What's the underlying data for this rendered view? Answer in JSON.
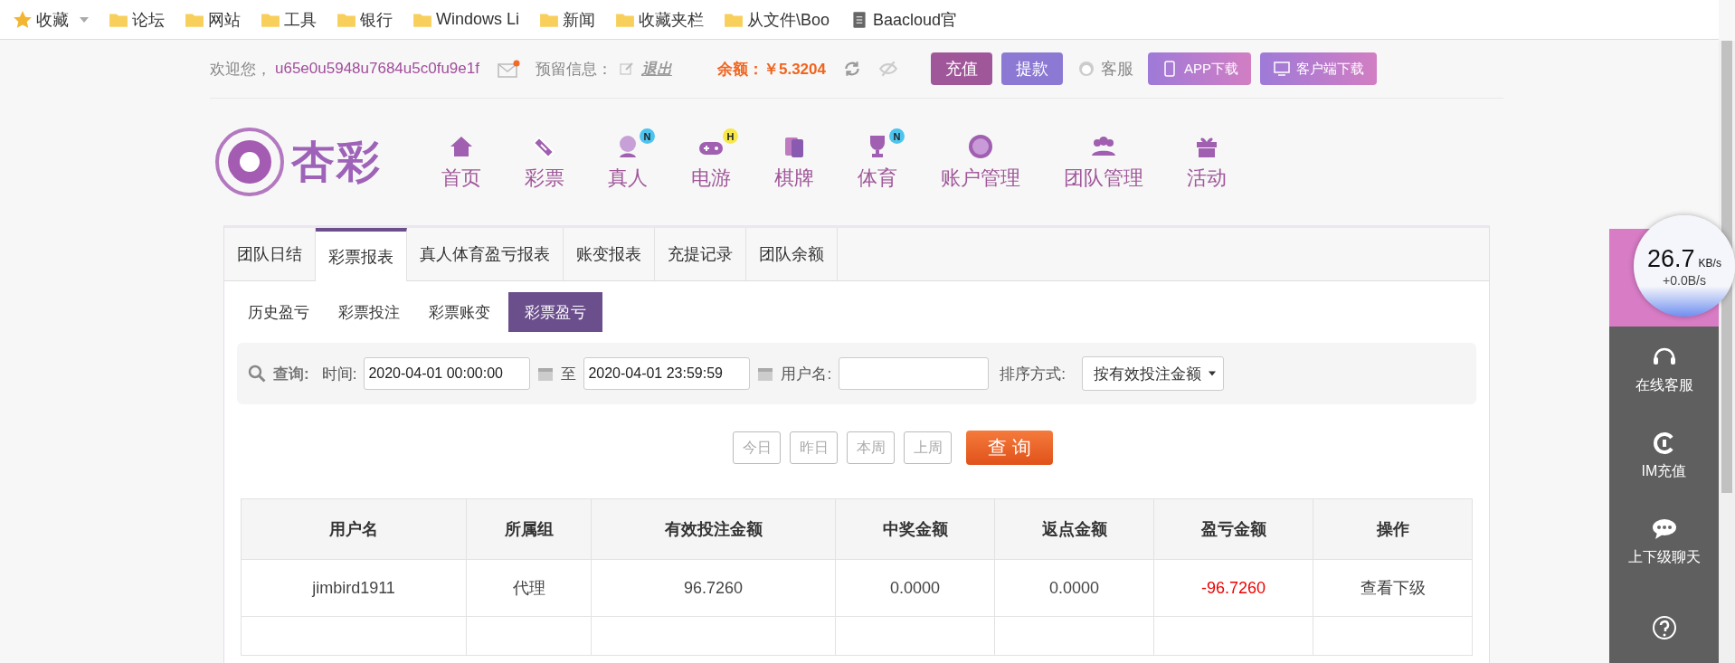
{
  "bookmarks": [
    {
      "label": "收藏",
      "kind": "star"
    },
    {
      "label": "论坛",
      "kind": "folder"
    },
    {
      "label": "网站",
      "kind": "folder"
    },
    {
      "label": "工具",
      "kind": "folder"
    },
    {
      "label": "银行",
      "kind": "folder"
    },
    {
      "label": "Windows Li",
      "kind": "folder"
    },
    {
      "label": "新闻",
      "kind": "folder"
    },
    {
      "label": "收藏夹栏",
      "kind": "folder"
    },
    {
      "label": "从文件\\Boo",
      "kind": "folder"
    },
    {
      "label": "Baacloud官",
      "kind": "page"
    }
  ],
  "header": {
    "greeting": "欢迎您，",
    "username": "u65e0u5948u7684u5c0fu9e1f",
    "mail_unread": true,
    "reserved_label": "预留信息：",
    "logout": "退出",
    "balance_label": "余额：",
    "balance": "￥5.3204",
    "buttons": [
      {
        "label": "充值",
        "kind": "deposit"
      },
      {
        "label": "提款",
        "kind": "withdraw"
      },
      {
        "label": "客服",
        "kind": "service"
      },
      {
        "label": "APP下载",
        "kind": "app"
      },
      {
        "label": "客户端下载",
        "kind": "client"
      }
    ]
  },
  "logo": {
    "text": "杏彩"
  },
  "nav": [
    {
      "label": "首页",
      "kind": "home"
    },
    {
      "label": "彩票",
      "kind": "ticket"
    },
    {
      "label": "真人",
      "kind": "person",
      "badge": "N"
    },
    {
      "label": "电游",
      "kind": "gamepad",
      "badge": "H"
    },
    {
      "label": "棋牌",
      "kind": "cards"
    },
    {
      "label": "体育",
      "kind": "trophy",
      "badge": "N"
    },
    {
      "label": "账户管理",
      "kind": "coin"
    },
    {
      "label": "团队管理",
      "kind": "team"
    },
    {
      "label": "活动",
      "kind": "gift"
    }
  ],
  "tabs": [
    {
      "label": "团队日结",
      "selected": false
    },
    {
      "label": "彩票报表",
      "selected": true
    },
    {
      "label": "真人体育盈亏报表",
      "selected": false
    },
    {
      "label": "账变报表",
      "selected": false
    },
    {
      "label": "充提记录",
      "selected": false
    },
    {
      "label": "团队余额",
      "selected": false
    }
  ],
  "subtabs": [
    {
      "label": "历史盈亏",
      "selected": false
    },
    {
      "label": "彩票投注",
      "selected": false
    },
    {
      "label": "彩票账变",
      "selected": false
    },
    {
      "label": "彩票盈亏",
      "selected": true
    }
  ],
  "filter": {
    "search_label": "查询:",
    "time_label": "时间:",
    "start": "2020-04-01 00:00:00",
    "to": "至",
    "end": "2020-04-01 23:59:59",
    "user_label": "用户名:",
    "sort_label": "排序方式:",
    "sort_value": "按有效投注金额"
  },
  "quick_buttons": [
    "今日",
    "昨日",
    "本周",
    "上周"
  ],
  "query_button": "查 询",
  "table": {
    "columns": [
      "用户名",
      "所属组",
      "有效投注金额",
      "中奖金额",
      "返点金额",
      "盈亏金额",
      "操作"
    ],
    "rows": [
      {
        "cells": [
          "jimbird1911",
          "代理",
          "96.7260",
          "0.0000",
          "0.0000",
          "-96.7260",
          "查看下级"
        ],
        "loss": true
      }
    ]
  },
  "sidebar": [
    {
      "kind": "back",
      "highlighted": true
    },
    {
      "label": "在线客服",
      "kind": "headset",
      "highlighted": false
    },
    {
      "label": "IM充值",
      "kind": "im",
      "highlighted": false
    },
    {
      "label": "上下级聊天",
      "kind": "chat",
      "highlighted": false
    },
    {
      "kind": "help",
      "highlighted": false
    }
  ],
  "speed": {
    "value": "26.7",
    "unit": "KB/s",
    "upload": "+0.0B/s"
  }
}
